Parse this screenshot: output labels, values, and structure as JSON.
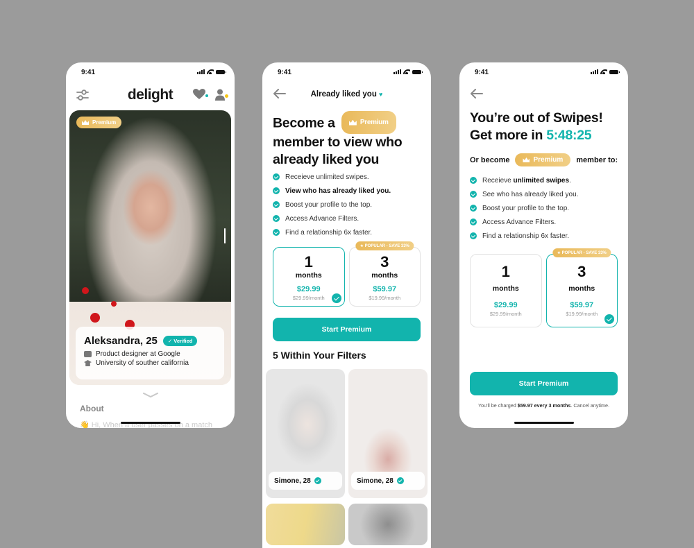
{
  "status_bar": {
    "time": "9:41"
  },
  "profile_screen": {
    "logo": "delight",
    "premium_badge": "Premium",
    "name_age": "Aleksandra, 25",
    "verified_label": "Verified",
    "job": "Product designer at Google",
    "school": "University of souther california",
    "about_title": "About",
    "about_text": "👋 Hi, When a user passes on a match"
  },
  "liked_screen": {
    "nav_title": "Already liked you",
    "headline_part1": "Become a",
    "premium_badge": "Premium",
    "headline_part2": "member to view who already liked you",
    "features": [
      {
        "text": "Receieve unlimited swipes.",
        "bold": false
      },
      {
        "text": "View who has already liked you.",
        "bold": true
      },
      {
        "text": "Boost your profile to the top.",
        "bold": false
      },
      {
        "text": "Access Advance Filters.",
        "bold": false
      },
      {
        "text": "Find a relationship 6x faster.",
        "bold": false
      }
    ],
    "plans": [
      {
        "num": "1",
        "unit": "months",
        "price": "$29.99",
        "per": "$29.99/month",
        "selected": true
      },
      {
        "num": "3",
        "unit": "months",
        "price": "$59.97",
        "per": "$19.99/month",
        "selected": false,
        "tag": "★ POPULAR - SAVE 33%"
      }
    ],
    "cta": "Start Premium",
    "section_title": "5 Within Your Filters",
    "matches": [
      {
        "name": "Simone, 28"
      },
      {
        "name": "Simone, 28"
      }
    ]
  },
  "swipes_screen": {
    "headline_line1": "You’re out of Swipes!",
    "headline_line2_prefix": "Get more in",
    "countdown": "5:48:25",
    "or_become": "Or become",
    "premium_badge": "Premium",
    "member_to": "member to:",
    "feature1_prefix": "Receieve",
    "feature1_bold": "unlimited swipes",
    "feature1_suffix": ".",
    "features": [
      "See who has already liked you.",
      "Boost your profile to the top.",
      "Access Advance Filters.",
      "Find a relationship 6x faster."
    ],
    "plans": [
      {
        "num": "1",
        "unit": "months",
        "price": "$29.99",
        "per": "$29.99/month",
        "selected": false
      },
      {
        "num": "3",
        "unit": "months",
        "price": "$59.97",
        "per": "$19.99/month",
        "selected": true,
        "tag": "★ POPULAR - SAVE 33%"
      }
    ],
    "cta": "Start Premium",
    "charge_prefix": "You'll be charged",
    "charge_bold": "$59.97 every 3 months",
    "charge_suffix": ". Cancel anytime."
  },
  "colors": {
    "accent": "#12b4ad",
    "gold": "#e9b95a",
    "background": "#9b9b9b"
  }
}
